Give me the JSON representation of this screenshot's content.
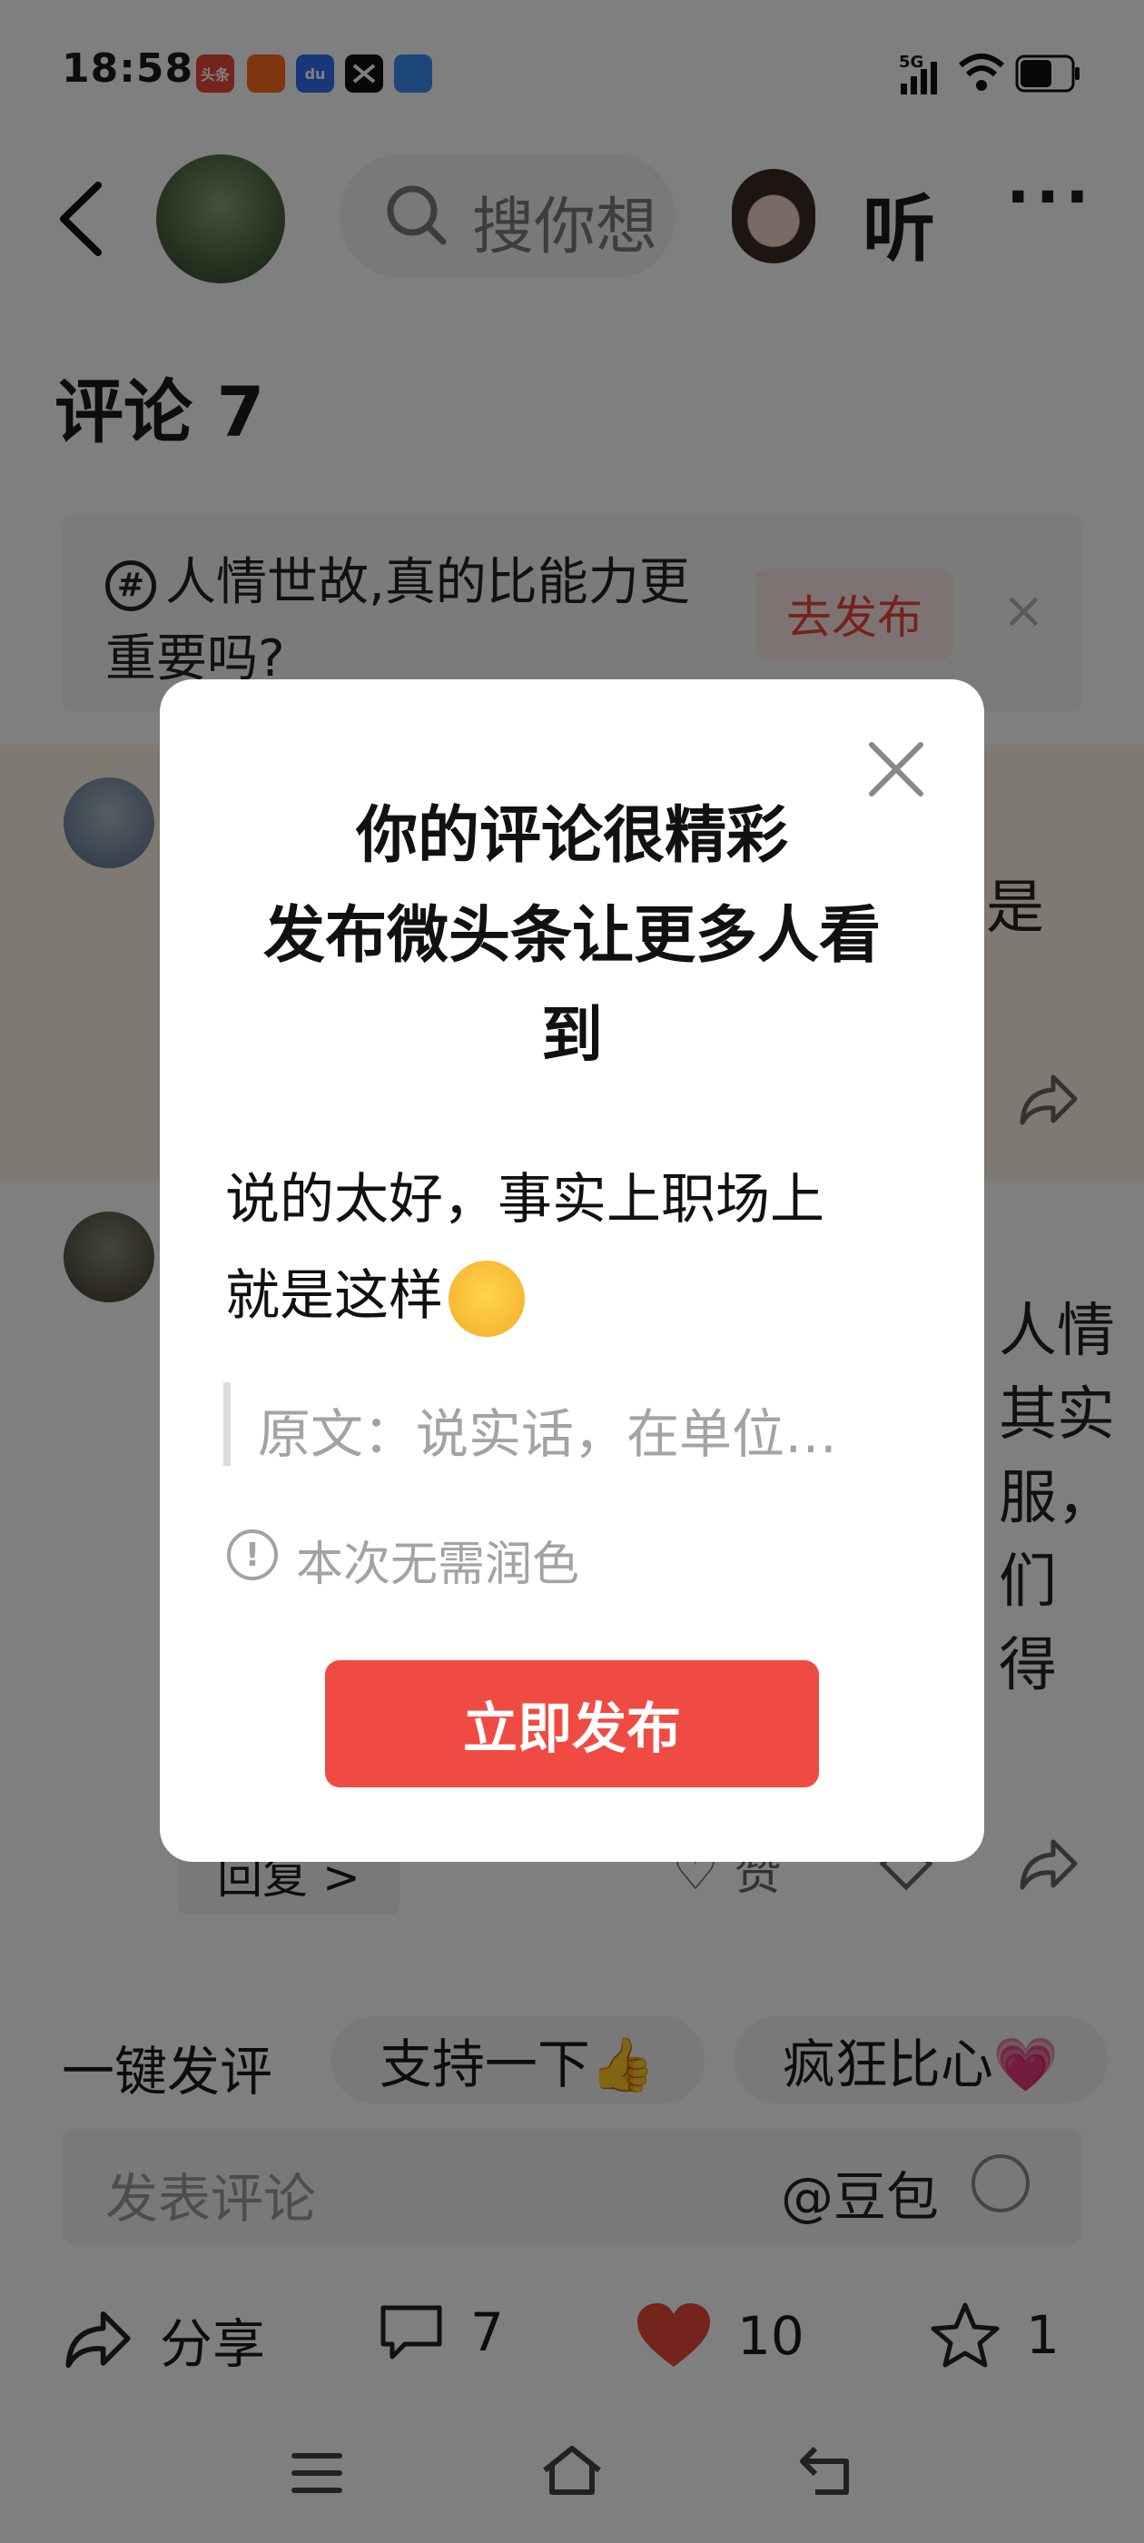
{
  "status_bar": {
    "time": "18:58",
    "apps": [
      {
        "name": "toutiao-app-icon",
        "label": "头条",
        "color": "#e8463b"
      },
      {
        "name": "kuaishou-app-icon",
        "label": "",
        "color": "#ff6a1a"
      },
      {
        "name": "baidu-app-icon",
        "label": "du",
        "color": "#2f6ef2"
      },
      {
        "name": "capcut-app-icon",
        "label": "",
        "color": "#111111"
      },
      {
        "name": "files-app-icon",
        "label": "",
        "color": "#3a8ef0"
      }
    ],
    "network": "5G",
    "battery_level": 0.6
  },
  "header": {
    "search_text": "搜你想",
    "listen_label": "听",
    "more_label": "···"
  },
  "comments": {
    "title": "评论 7",
    "topic_banner": {
      "text": "人情世故,真的比能力更重要吗?",
      "publish_label": "去发布",
      "close_label": "×"
    },
    "comment1_fragment": "是",
    "comment2_fragments": [
      "人情",
      "其实",
      "服，",
      "们",
      "得"
    ],
    "reply_label": "回复 >",
    "like_label": "赞"
  },
  "quick_comment": {
    "label": "一键发评",
    "chips": [
      "支持一下👍",
      "疯狂比心💗"
    ]
  },
  "input": {
    "placeholder": "发表评论",
    "doubao_label": "@豆包"
  },
  "action_bar": {
    "share_label": "分享",
    "comment_count": "7",
    "like_count": "10",
    "favorite_count": "1",
    "like_color": "#e8463b"
  },
  "dialog": {
    "title_line1": "你的评论很精彩",
    "title_line2": "发布微头条让更多人看",
    "title_line3": "到",
    "body_line1": "说的太好，事实上职场上",
    "body_line2": "就是这样",
    "quote": "原文：说实话，在单位…",
    "notice": "本次无需润色",
    "publish_button": "立即发布",
    "accent": "#f04b42"
  }
}
